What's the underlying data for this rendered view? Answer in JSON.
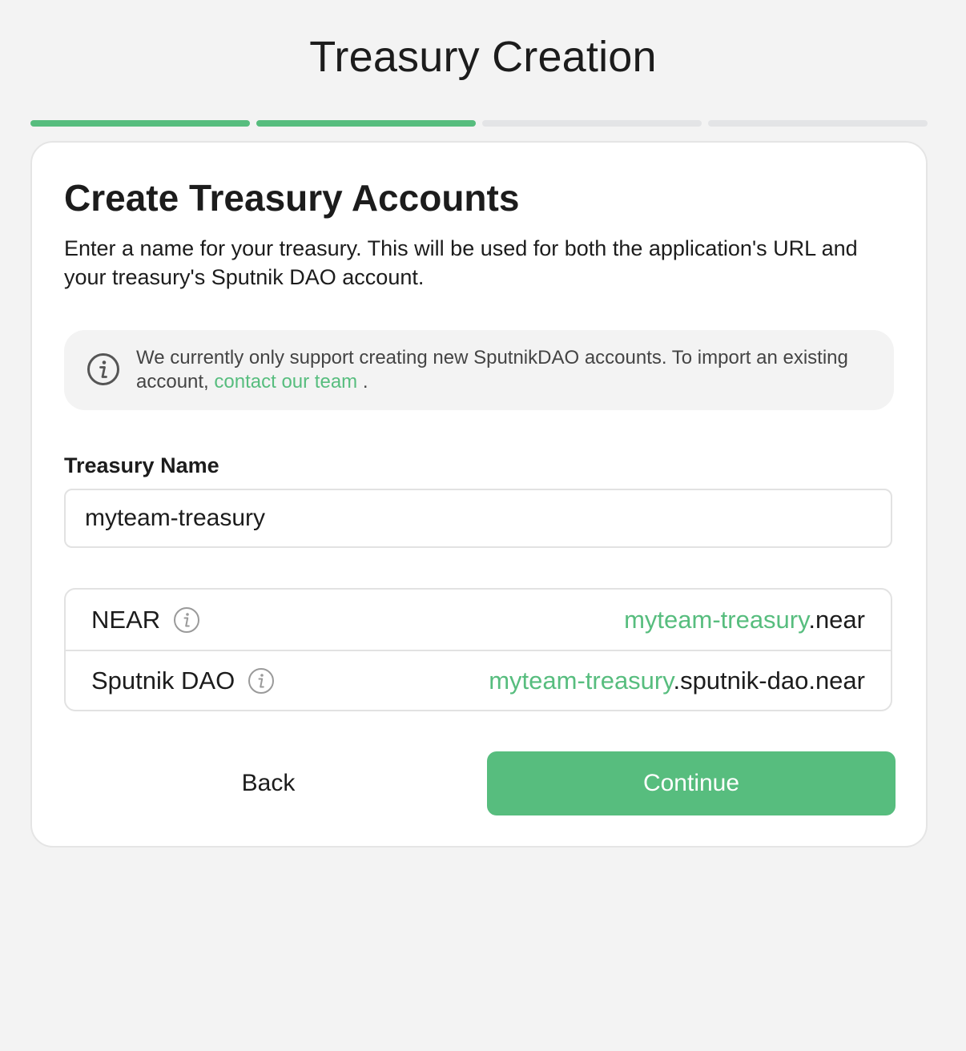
{
  "page": {
    "title": "Treasury Creation"
  },
  "progress": {
    "total_steps": 4,
    "completed_steps": 2
  },
  "card": {
    "title": "Create Treasury Accounts",
    "description": "Enter a name for your treasury. This will be used for both the application's URL and your treasury's Sputnik DAO account."
  },
  "info": {
    "icon": "info-icon",
    "text_before": "We currently only support creating new SputnikDAO accounts. To import an existing account, ",
    "link_text": "contact our team",
    "text_after": " ."
  },
  "form": {
    "name_label": "Treasury Name",
    "name_value": "myteam-treasury"
  },
  "accounts": [
    {
      "label": "NEAR",
      "icon": "info-icon",
      "value_highlight": "myteam-treasury",
      "value_suffix": ".near"
    },
    {
      "label": "Sputnik DAO",
      "icon": "info-icon",
      "value_highlight": "myteam-treasury",
      "value_suffix": ".sputnik-dao.near"
    }
  ],
  "actions": {
    "back_label": "Back",
    "continue_label": "Continue"
  },
  "colors": {
    "accent": "#57bd7e",
    "background": "#f3f3f3",
    "progress_inactive": "#e3e4e6"
  }
}
